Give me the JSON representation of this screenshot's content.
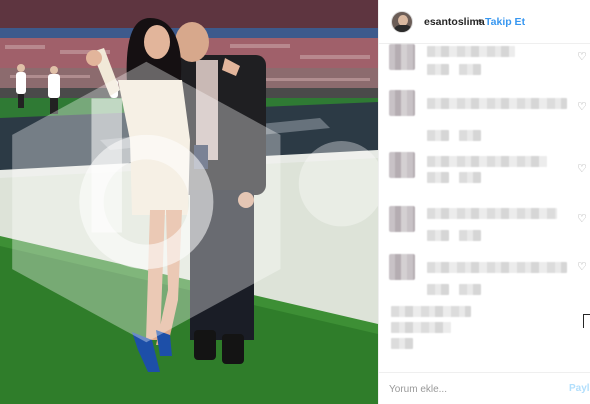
{
  "header": {
    "username": "esantoslima",
    "separator": "•",
    "follow_label": "Takip Et"
  },
  "comments": [
    {
      "author": "",
      "text": "",
      "liked": false
    },
    {
      "author": "",
      "text": "",
      "liked": false
    },
    {
      "author": "",
      "text": "",
      "liked": false
    },
    {
      "author": "",
      "text": "",
      "liked": false
    },
    {
      "author": "",
      "text": "",
      "liked": false
    },
    {
      "author": "",
      "text": "",
      "liked": false
    }
  ],
  "icons": {
    "like": "heart-icon",
    "save": "bookmark-icon",
    "avatar": "user-avatar"
  },
  "footer": {
    "comment_placeholder": "Yorum ekle...",
    "post_label": "Paylaş"
  },
  "colors": {
    "link": "#3897f0",
    "post_disabled": "#b2dffc",
    "text": "#262626"
  }
}
